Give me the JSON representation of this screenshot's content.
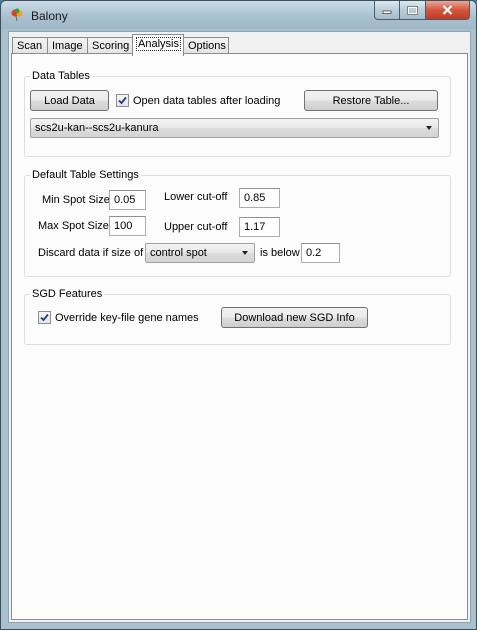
{
  "window": {
    "title": "Balony",
    "minimize_label": "—",
    "maximize_label": "☐",
    "close_label": "✕"
  },
  "tabs": [
    {
      "label": "Scan"
    },
    {
      "label": "Image"
    },
    {
      "label": "Scoring"
    },
    {
      "label": "Analysis",
      "active": true
    },
    {
      "label": "Options"
    }
  ],
  "data_tables": {
    "title": "Data Tables",
    "load_button": "Load Data",
    "open_after_loading_label": "Open data tables after loading",
    "open_after_loading_checked": true,
    "restore_button": "Restore Table...",
    "selected_table": "scs2u-kan--scs2u-kanura"
  },
  "default_settings": {
    "title": "Default Table Settings",
    "min_spot_label": "Min Spot Size",
    "min_spot_value": "0.05",
    "max_spot_label": "Max Spot Size",
    "max_spot_value": "100",
    "lower_cutoff_label": "Lower cut-off",
    "lower_cutoff_value": "0.85",
    "upper_cutoff_label": "Upper cut-off",
    "upper_cutoff_value": "1.17",
    "discard_label": "Discard data if size of",
    "discard_select": "control spot",
    "is_below_label": "is below",
    "is_below_value": "0.2"
  },
  "sgd": {
    "title": "SGD Features",
    "override_label": "Override key-file gene names",
    "override_checked": true,
    "download_button": "Download new SGD Info"
  },
  "colors": {
    "titlebar": "#a9c0ce",
    "panel_bg": "#fcfcfc",
    "close_button": "#c13c22"
  }
}
